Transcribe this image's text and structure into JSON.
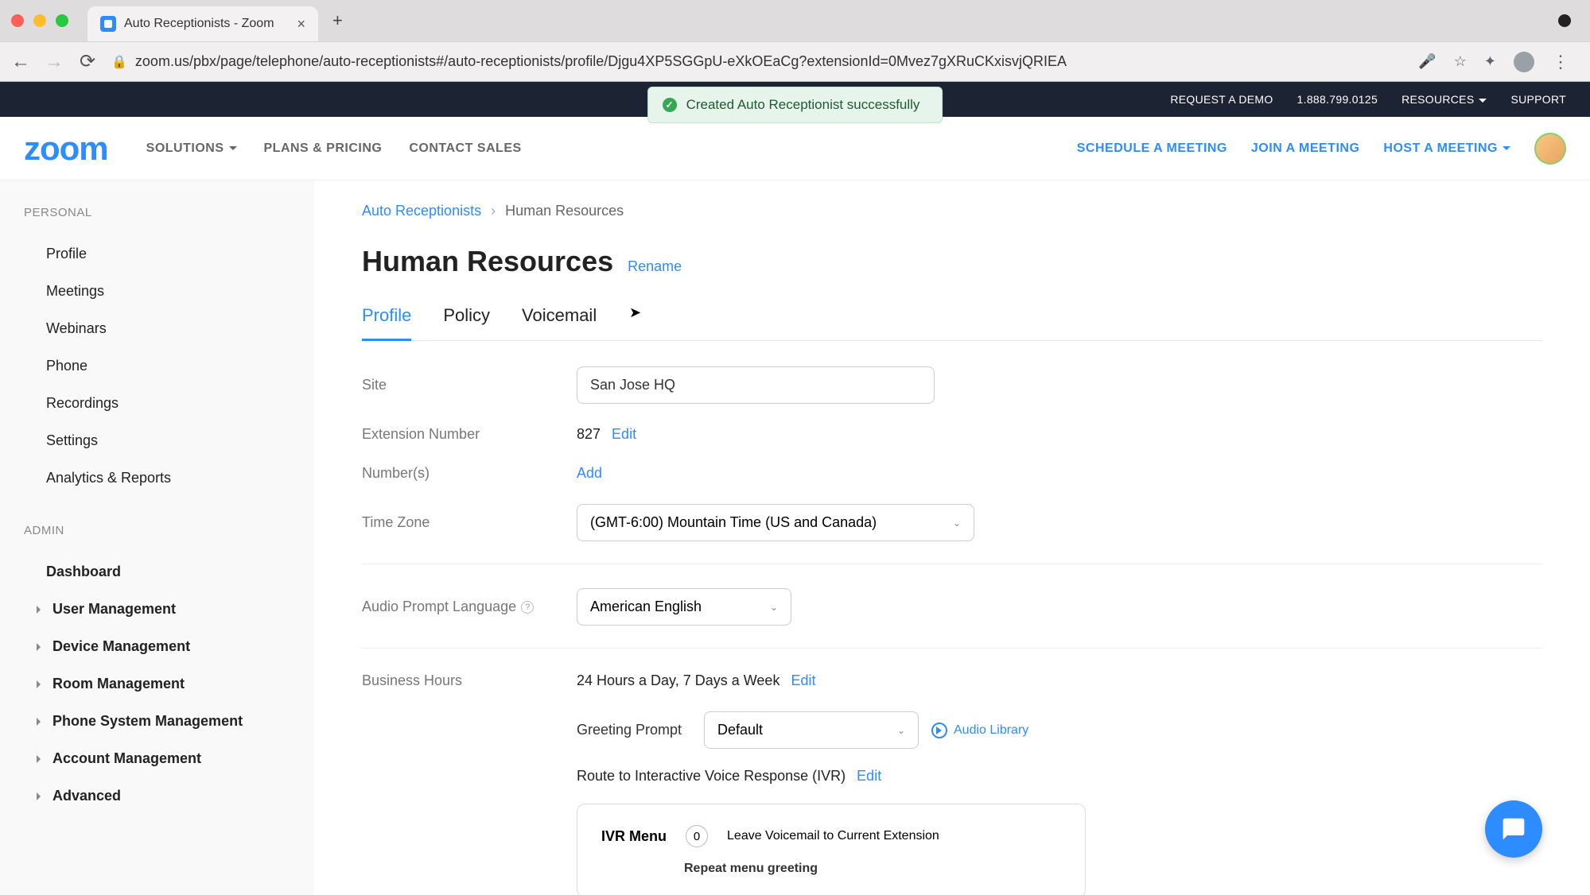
{
  "browser": {
    "tab_title": "Auto Receptionists - Zoom",
    "url": "zoom.us/pbx/page/telephone/auto-receptionists#/auto-receptionists/profile/Djgu4XP5SGGpU-eXkOEaCg?extensionId=0Mvez7gXRuCKxisvjQRIEA"
  },
  "top_bar": {
    "request_demo": "REQUEST A DEMO",
    "phone": "1.888.799.0125",
    "resources": "RESOURCES",
    "support": "SUPPORT"
  },
  "toast": {
    "message": "Created Auto Receptionist successfully"
  },
  "nav": {
    "logo": "zoom",
    "solutions": "SOLUTIONS",
    "plans": "PLANS & PRICING",
    "contact": "CONTACT SALES",
    "schedule": "SCHEDULE A MEETING",
    "join": "JOIN A MEETING",
    "host": "HOST A MEETING"
  },
  "sidebar": {
    "personal": "PERSONAL",
    "items_personal": [
      "Profile",
      "Meetings",
      "Webinars",
      "Phone",
      "Recordings",
      "Settings",
      "Analytics & Reports"
    ],
    "admin": "ADMIN",
    "dashboard": "Dashboard",
    "items_admin": [
      "User Management",
      "Device Management",
      "Room Management",
      "Phone System Management",
      "Account Management",
      "Advanced"
    ]
  },
  "breadcrumb": {
    "parent": "Auto Receptionists",
    "current": "Human Resources"
  },
  "page": {
    "title": "Human Resources",
    "rename": "Rename"
  },
  "tabs": [
    "Profile",
    "Policy",
    "Voicemail"
  ],
  "form": {
    "site_label": "Site",
    "site_value": "San Jose HQ",
    "ext_label": "Extension Number",
    "ext_value": "827",
    "edit": "Edit",
    "numbers_label": "Number(s)",
    "add": "Add",
    "tz_label": "Time Zone",
    "tz_value": "(GMT-6:00) Mountain Time (US and Canada)",
    "lang_label": "Audio Prompt Language",
    "lang_value": "American English",
    "hours_label": "Business Hours",
    "hours_value": "24 Hours a Day, 7 Days a Week",
    "greeting_label": "Greeting Prompt",
    "greeting_value": "Default",
    "audio_library": "Audio Library",
    "route_label": "Route to Interactive Voice Response (IVR)",
    "ivr_menu": "IVR Menu",
    "ivr_key": "0",
    "ivr_action": "Leave Voicemail to Current Extension",
    "ivr_repeat": "Repeat menu greeting"
  }
}
